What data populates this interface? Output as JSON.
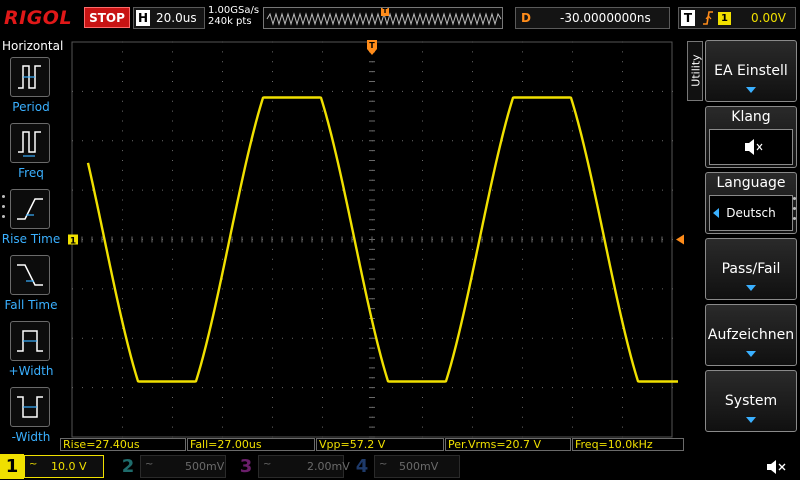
{
  "header": {
    "brand": "RIGOL",
    "run_state": "STOP",
    "timebase_letter": "H",
    "timebase": "20.0us",
    "sample_rate": "1.00GSa/s",
    "memory_depth": "240k pts",
    "delay_letter": "D",
    "delay": "-30.0000000ns",
    "trigger_letter": "T",
    "trigger_edge": "rising-edge-icon",
    "trigger_source": "1",
    "trigger_level": "0.00V"
  },
  "left_menu": {
    "title": "Horizontal",
    "items": [
      {
        "label": "Period",
        "icon": "period-icon"
      },
      {
        "label": "Freq",
        "icon": "frequency-icon"
      },
      {
        "label": "Rise Time",
        "icon": "rise-time-icon"
      },
      {
        "label": "Fall Time",
        "icon": "fall-time-icon"
      },
      {
        "label": "+Width",
        "icon": "positive-width-icon"
      },
      {
        "label": "-Width",
        "icon": "negative-width-icon"
      }
    ]
  },
  "right_menu": {
    "tab": "Utility",
    "buttons": [
      {
        "label": "EA Einstell",
        "type": "submenu"
      },
      {
        "label": "Klang",
        "type": "toggle",
        "icon": "speaker-mute-icon"
      },
      {
        "label": "Language",
        "type": "select",
        "value": "Deutsch"
      },
      {
        "label": "Pass/Fail",
        "type": "submenu"
      },
      {
        "label": "Aufzeichnen",
        "type": "submenu"
      },
      {
        "label": "System",
        "type": "submenu"
      }
    ]
  },
  "markers": {
    "channel1_ground": "1",
    "trigger_position": "T"
  },
  "measurements": [
    {
      "text": "Rise=27.40us"
    },
    {
      "text": "Fall=27.00us"
    },
    {
      "text": "Vpp=57.2 V"
    },
    {
      "text": "Per.Vrms=20.7 V"
    },
    {
      "text": "Freq=10.0kHz"
    }
  ],
  "channels": [
    {
      "num": "1",
      "coupling": "~",
      "scale": "10.0 V",
      "active": true,
      "color": "#f0e000"
    },
    {
      "num": "2",
      "coupling": "~",
      "scale": "500mV",
      "active": false,
      "color": "#1e6b6b"
    },
    {
      "num": "3",
      "coupling": "~",
      "scale": "2.00mV",
      "active": false,
      "color": "#6a1e6a"
    },
    {
      "num": "4",
      "coupling": "~",
      "scale": "500mV",
      "active": false,
      "color": "#1e3a6a"
    }
  ],
  "colors": {
    "ch1": "#f0e000",
    "trigger": "#ff8c1a",
    "accent": "#3ab0ff",
    "brand": "#e01818"
  },
  "waveform": {
    "channel": "1",
    "shape": "clipped-sine",
    "frequency_hz": 10000,
    "peak_to_peak_v": 57.2,
    "clipped": true
  }
}
